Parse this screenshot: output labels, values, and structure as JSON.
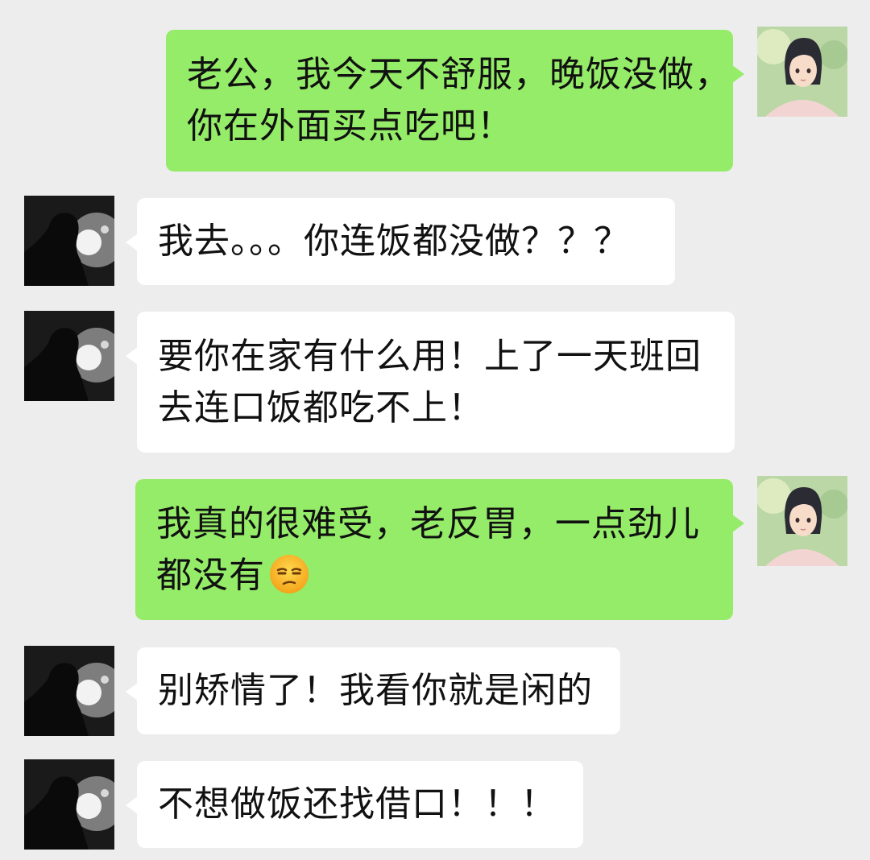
{
  "messages": [
    {
      "side": "sent",
      "lines": [
        "老公，我今天不舒服，晚饭没做，",
        "你在外面买点吃吧！"
      ]
    },
    {
      "side": "recv",
      "lines": [
        "我去。。。你连饭都没做？？？"
      ]
    },
    {
      "side": "recv",
      "lines": [
        "要你在家有什么用！上了一天班回",
        "去连口饭都吃不上！"
      ]
    },
    {
      "side": "sent",
      "lines": [
        "我真的很难受，老反胃，一点劲儿",
        "都没有"
      ],
      "emoji": "unamused-face-emoji"
    },
    {
      "side": "recv",
      "lines": [
        "别矫情了！我看你就是闲的"
      ]
    },
    {
      "side": "recv",
      "lines": [
        "不想做饭还找借口！！！"
      ]
    }
  ],
  "avatars": {
    "wife": "illustrated-girl-avatar",
    "husband": "dark-silhouette-avatar"
  },
  "colors": {
    "background": "#ededed",
    "sent_bubble": "#95ec69",
    "recv_bubble": "#ffffff"
  }
}
